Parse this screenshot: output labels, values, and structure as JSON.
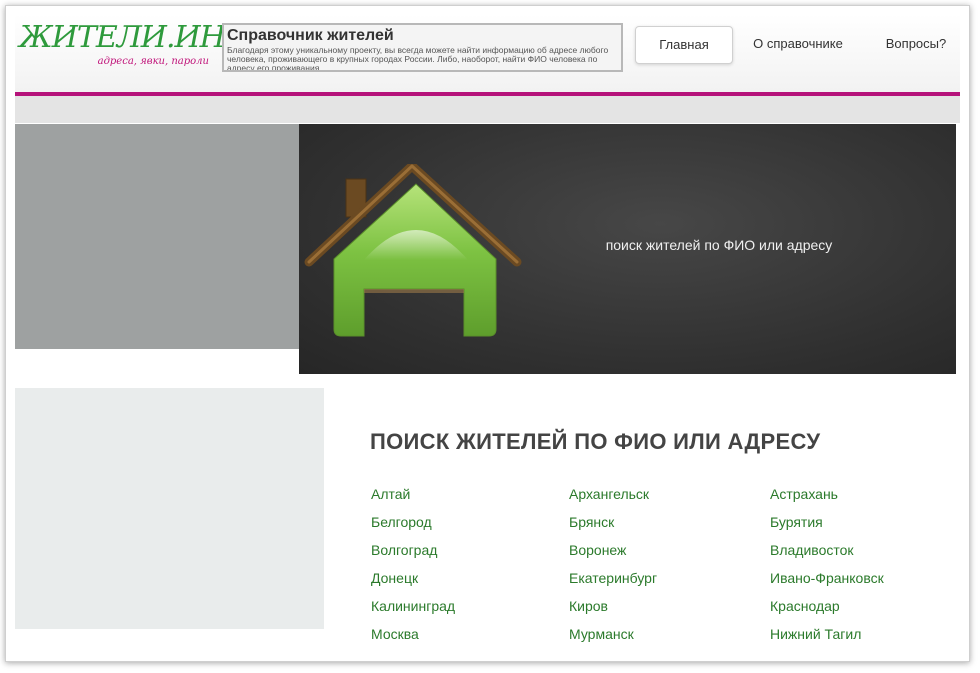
{
  "logo": {
    "main": "ЖИТЕЛИ.ИНФО",
    "sub": "адреса, явки, пароли"
  },
  "infobox": {
    "title": "Справочник жителей",
    "text": "Благодаря этому уникальному проекту, вы всегда можете найти информацию об адресе любого человека, проживающего в крупных городах России. Либо, наоборот, найти ФИО человека по адресу его проживания."
  },
  "nav": [
    {
      "label": "Главная"
    },
    {
      "label": "О справочнике"
    },
    {
      "label": "Вопросы?"
    }
  ],
  "banner": {
    "text": "поиск жителей по ФИО или адресу"
  },
  "main": {
    "title": "ПОИСК ЖИТЕЛЕЙ ПО ФИО ИЛИ АДРЕСУ"
  },
  "cities": [
    [
      "Алтай",
      "Архангельск",
      "Астрахань"
    ],
    [
      "Белгород",
      "Брянск",
      "Бурятия"
    ],
    [
      "Волгоград",
      "Воронеж",
      "Владивосток"
    ],
    [
      "Донецк",
      "Екатеринбург",
      "Ивано-Франковск"
    ],
    [
      "Калининград",
      "Киров",
      "Краснодар"
    ],
    [
      "Москва",
      "Мурманск",
      "Нижний Тагил"
    ]
  ],
  "colors": {
    "accent": "#b5127a",
    "link": "#2b7a2b",
    "logo": "#2e9a3c",
    "house": "#7dc242",
    "roof": "#6b4a22"
  }
}
